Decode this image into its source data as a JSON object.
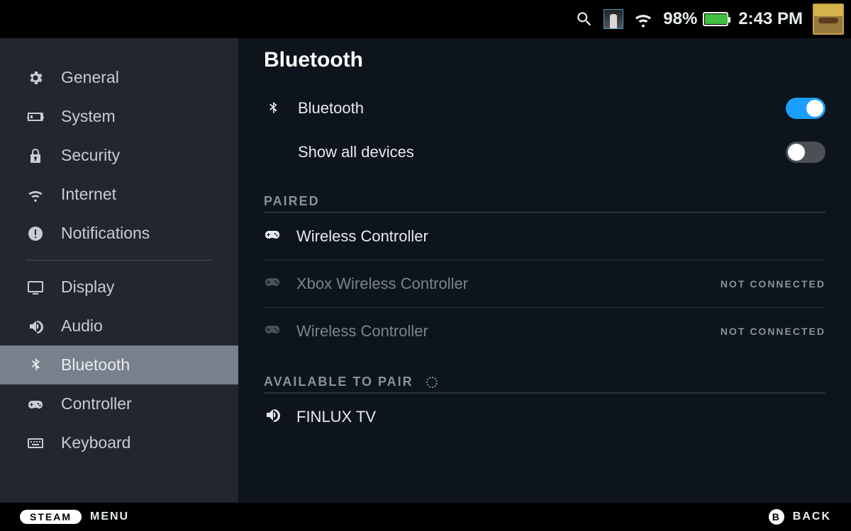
{
  "topbar": {
    "battery_percent": "98%",
    "battery_fill_pct": 98,
    "clock": "2:43 PM"
  },
  "sidebar": {
    "items": [
      {
        "icon": "gear",
        "label": "General"
      },
      {
        "icon": "console",
        "label": "System"
      },
      {
        "icon": "lock",
        "label": "Security"
      },
      {
        "icon": "wifi",
        "label": "Internet"
      },
      {
        "icon": "alert",
        "label": "Notifications"
      },
      {
        "divider": true
      },
      {
        "icon": "display",
        "label": "Display"
      },
      {
        "icon": "audio",
        "label": "Audio"
      },
      {
        "icon": "bluetooth",
        "label": "Bluetooth",
        "active": true
      },
      {
        "icon": "controller",
        "label": "Controller"
      },
      {
        "icon": "keyboard",
        "label": "Keyboard"
      }
    ]
  },
  "content": {
    "title": "Bluetooth",
    "toggles": [
      {
        "icon": "bluetooth",
        "label": "Bluetooth",
        "on": true
      },
      {
        "icon": "",
        "label": "Show all devices",
        "on": false
      }
    ],
    "paired_header": "PAIRED",
    "paired": [
      {
        "icon": "controller",
        "label": "Wireless Controller",
        "status": ""
      },
      {
        "icon": "controller",
        "label": "Xbox Wireless Controller",
        "status": "NOT CONNECTED",
        "dim": true
      },
      {
        "icon": "controller",
        "label": "Wireless Controller",
        "status": "NOT CONNECTED",
        "dim": true
      }
    ],
    "available_header": "AVAILABLE TO PAIR",
    "available": [
      {
        "icon": "audio",
        "label": "FINLUX TV"
      }
    ]
  },
  "footer": {
    "steam_label": "STEAM",
    "menu_label": "MENU",
    "back_button": "B",
    "back_label": "BACK"
  }
}
